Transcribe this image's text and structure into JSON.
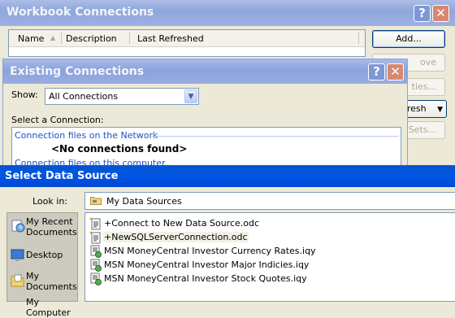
{
  "workbook_connections": {
    "title": "Workbook Connections",
    "columns": [
      "Name",
      "Description",
      "Last Refreshed"
    ],
    "buttons": {
      "add": "Add...",
      "remove_partial": "ove",
      "properties_partial": "ties...",
      "refresh_partial": "resh",
      "sets_partial": "Sets..."
    }
  },
  "existing_connections": {
    "title": "Existing Connections",
    "show_label": "Show:",
    "show_value": "All Connections",
    "select_label": "Select a Connection:",
    "groups": [
      {
        "label": "Connection files on the Network",
        "empty_text": "<No connections found>"
      },
      {
        "label": "Connection files on this computer"
      }
    ]
  },
  "select_data_source": {
    "title": "Select Data Source",
    "look_in_label": "Look in:",
    "look_in_value": "My Data Sources",
    "places": [
      {
        "label": "My Recent Documents",
        "icon": "recent-documents-icon"
      },
      {
        "label": "Desktop",
        "icon": "desktop-icon"
      },
      {
        "label": "My Documents",
        "icon": "my-documents-icon"
      },
      {
        "label": "My Computer",
        "icon": "my-computer-icon"
      }
    ],
    "files": [
      {
        "name": "+Connect to New Data Source.odc",
        "icon": "odc-file-icon"
      },
      {
        "name": "+NewSQLServerConnection.odc",
        "icon": "odc-file-icon"
      },
      {
        "name": "MSN MoneyCentral Investor Currency Rates.iqy",
        "icon": "iqy-file-icon"
      },
      {
        "name": "MSN MoneyCentral Investor Major Indicies.iqy",
        "icon": "iqy-file-icon"
      },
      {
        "name": "MSN MoneyCentral Investor Stock Quotes.iqy",
        "icon": "iqy-file-icon"
      }
    ]
  },
  "colors": {
    "title_active": "#0055e5",
    "title_inactive": "#8ea7db",
    "dialog_bg": "#ece9d8",
    "close_inactive": "#d8886e"
  }
}
